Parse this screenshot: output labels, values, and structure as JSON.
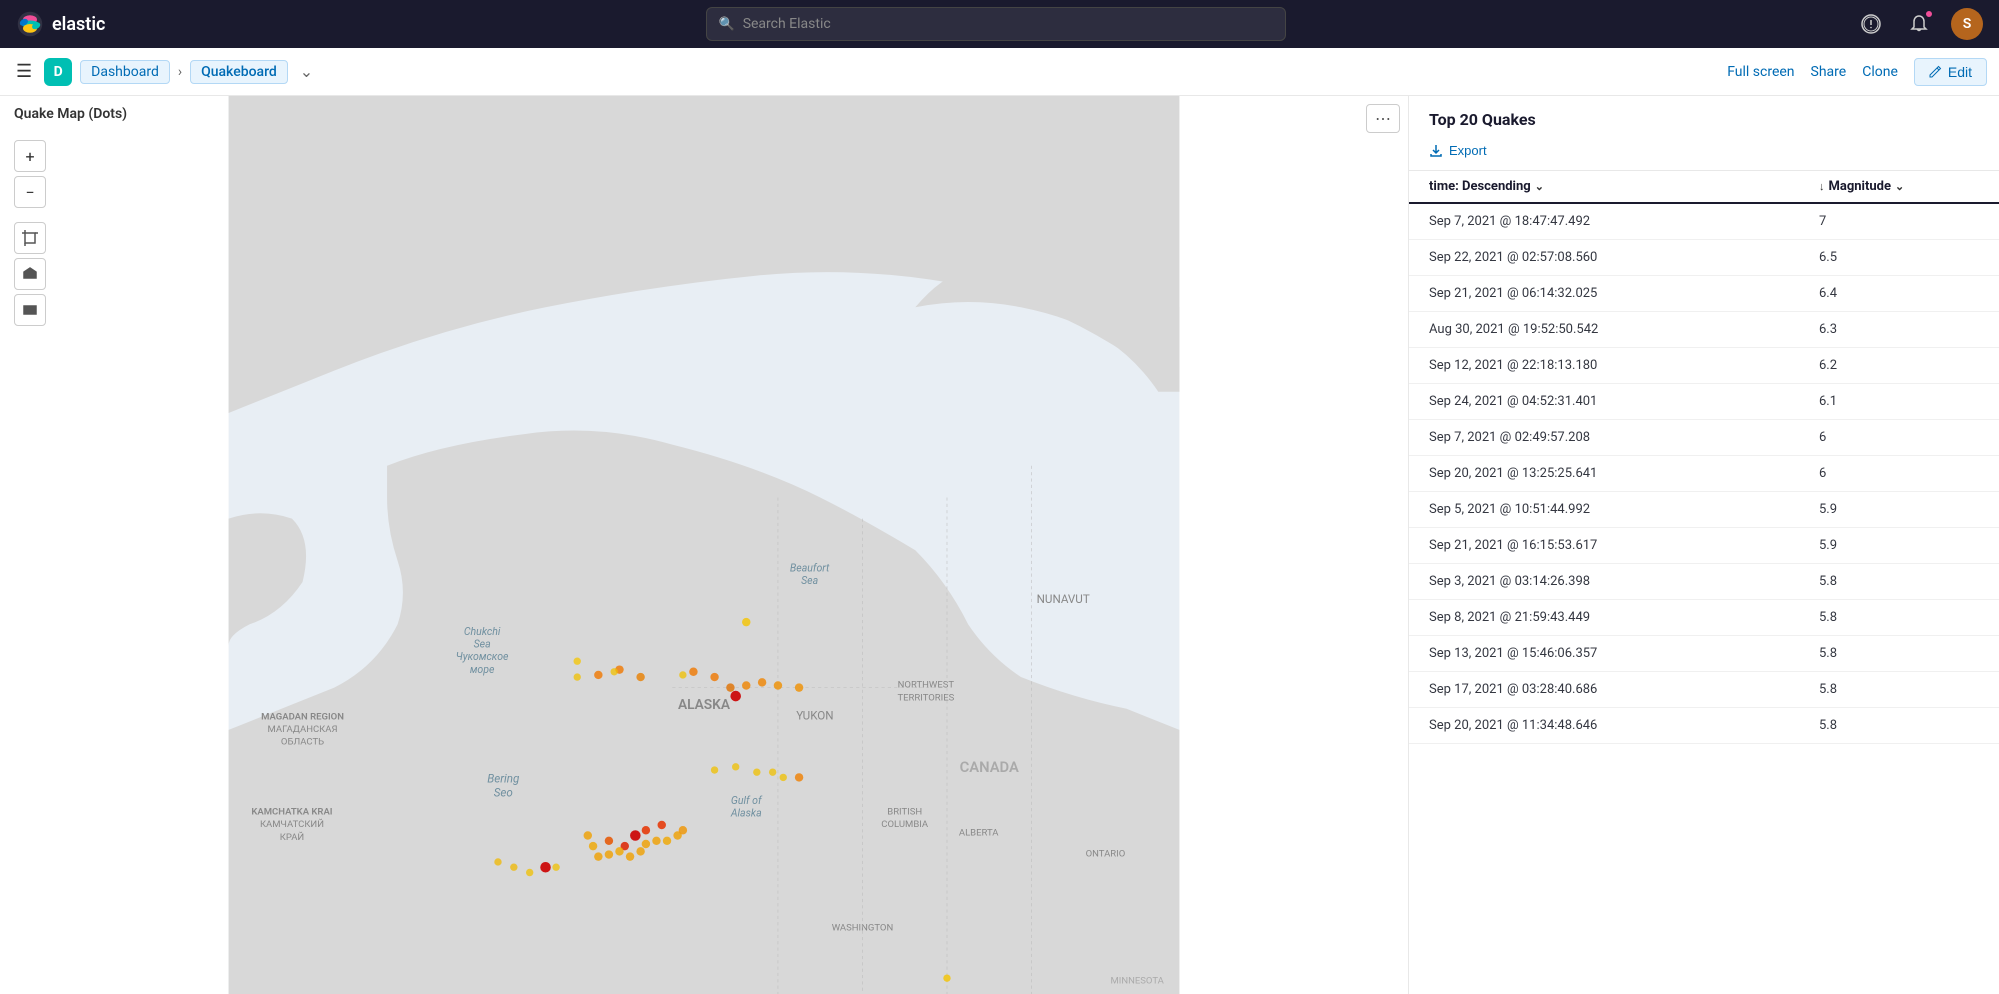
{
  "topnav": {
    "logo_text": "elastic",
    "search_placeholder": "Search Elastic",
    "nav_icons": [
      "alert-icon",
      "bell-icon",
      "avatar-icon"
    ],
    "avatar_letter": "S"
  },
  "breadcrumb": {
    "d_label": "D",
    "dashboard_label": "Dashboard",
    "current_label": "Quakeboard"
  },
  "actions": {
    "fullscreen_label": "Full screen",
    "share_label": "Share",
    "clone_label": "Clone",
    "edit_label": "Edit"
  },
  "map_panel": {
    "title": "Quake Map (Dots)"
  },
  "table_panel": {
    "title": "Top 20 Quakes",
    "export_label": "Export",
    "col_time_label": "time: Descending",
    "col_magnitude_label": "Magnitude",
    "rows": [
      {
        "time": "Sep 7, 2021 @ 18:47:47.492",
        "magnitude": "7"
      },
      {
        "time": "Sep 22, 2021 @ 02:57:08.560",
        "magnitude": "6.5"
      },
      {
        "time": "Sep 21, 2021 @ 06:14:32.025",
        "magnitude": "6.4"
      },
      {
        "time": "Aug 30, 2021 @ 19:52:50.542",
        "magnitude": "6.3"
      },
      {
        "time": "Sep 12, 2021 @ 22:18:13.180",
        "magnitude": "6.2"
      },
      {
        "time": "Sep 24, 2021 @ 04:52:31.401",
        "magnitude": "6.1"
      },
      {
        "time": "Sep 7, 2021 @ 02:49:57.208",
        "magnitude": "6"
      },
      {
        "time": "Sep 20, 2021 @ 13:25:25.641",
        "magnitude": "6"
      },
      {
        "time": "Sep 5, 2021 @ 10:51:44.992",
        "magnitude": "5.9"
      },
      {
        "time": "Sep 21, 2021 @ 16:15:53.617",
        "magnitude": "5.9"
      },
      {
        "time": "Sep 3, 2021 @ 03:14:26.398",
        "magnitude": "5.8"
      },
      {
        "time": "Sep 8, 2021 @ 21:59:43.449",
        "magnitude": "5.8"
      },
      {
        "time": "Sep 13, 2021 @ 15:46:06.357",
        "magnitude": "5.8"
      },
      {
        "time": "Sep 17, 2021 @ 03:28:40.686",
        "magnitude": "5.8"
      },
      {
        "time": "Sep 20, 2021 @ 11:34:48.646",
        "magnitude": "5.8"
      }
    ]
  },
  "map_labels": {
    "magadan": "MAGADAN REGION\nМАГАДАНСКАЯ\nОБЛАСТЬ",
    "kamchatka": "KAMCHATKA KRAI\nКАМЧАТСКИЙ\nКРАЙ",
    "alaska": "ALASKA",
    "yukon": "YUKON",
    "northwest_territories": "NORTHWEST\nTERRITORIES",
    "nunavut": "NUNAVUT",
    "canada": "CANADA",
    "british_columbia": "BRITISH\nCOLUMBIA",
    "alberta": "ALBERTA",
    "ontario": "ONTARIO",
    "washington": "WASHINGTON",
    "chukchi": "Chukchi\nSea\nЧукомское\nморе",
    "beaufort": "Beaufort\nSea",
    "bering": "Bering\nSea",
    "gulf_alaska": "Gulf of\nAlaska",
    "minnesota": "MINNESOTA"
  }
}
